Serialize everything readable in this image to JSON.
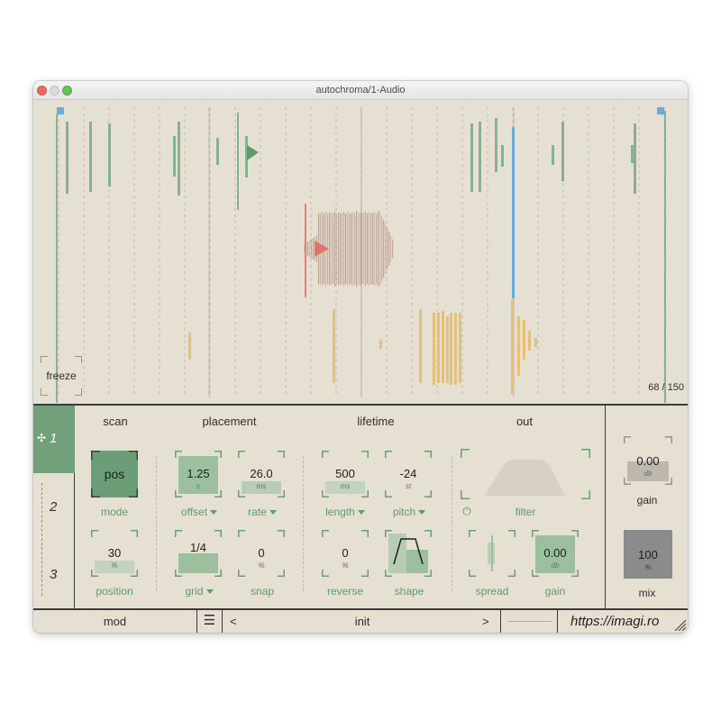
{
  "window": {
    "title": "autochroma/1-Audio"
  },
  "waveform": {
    "freeze_label": "freeze",
    "counter_current": "68",
    "counter_sep": "/",
    "counter_total": "150",
    "colors": {
      "green": "#7fb08a",
      "red": "#e0746a",
      "yellow": "#e4bd6e",
      "blue": "#6aa9d8",
      "grid": "#a8a298"
    }
  },
  "tabs": [
    {
      "label": "1",
      "active": true,
      "icon": "modulation-icon"
    },
    {
      "label": "2",
      "active": false
    },
    {
      "label": "3",
      "active": false
    }
  ],
  "sections": {
    "scan": {
      "title": "scan",
      "mode": {
        "value": "pos",
        "label": "mode"
      },
      "position": {
        "value": "30",
        "unit": "%",
        "label": "position"
      }
    },
    "placement": {
      "title": "placement",
      "offset": {
        "value": "1.25",
        "unit": "s",
        "label": "offset"
      },
      "rate": {
        "value": "26.0",
        "unit": "ms",
        "label": "rate"
      },
      "grid": {
        "value": "1/4",
        "label": "grid"
      },
      "snap": {
        "value": "0",
        "unit": "%",
        "label": "snap"
      }
    },
    "lifetime": {
      "title": "lifetime",
      "length": {
        "value": "500",
        "unit": "ms",
        "label": "length"
      },
      "pitch": {
        "value": "-24",
        "unit": "st",
        "label": "pitch"
      },
      "reverse": {
        "value": "0",
        "unit": "%",
        "label": "reverse"
      },
      "shape": {
        "label": "shape"
      }
    },
    "out": {
      "title": "out",
      "filter": {
        "label": "filter",
        "power_icon": "power-icon"
      },
      "spread": {
        "label": "spread"
      },
      "gain": {
        "value": "0.00",
        "unit": "db",
        "label": "gain"
      }
    },
    "master": {
      "gain": {
        "value": "0.00",
        "unit": "db",
        "label": "gain"
      },
      "mix": {
        "value": "100",
        "unit": "%",
        "label": "mix"
      }
    }
  },
  "bottom": {
    "mod_label": "mod",
    "menu_icon": "hamburger-icon",
    "prev_label": "<",
    "preset_name": "init",
    "next_label": ">",
    "url": "https://imagi.ro"
  }
}
